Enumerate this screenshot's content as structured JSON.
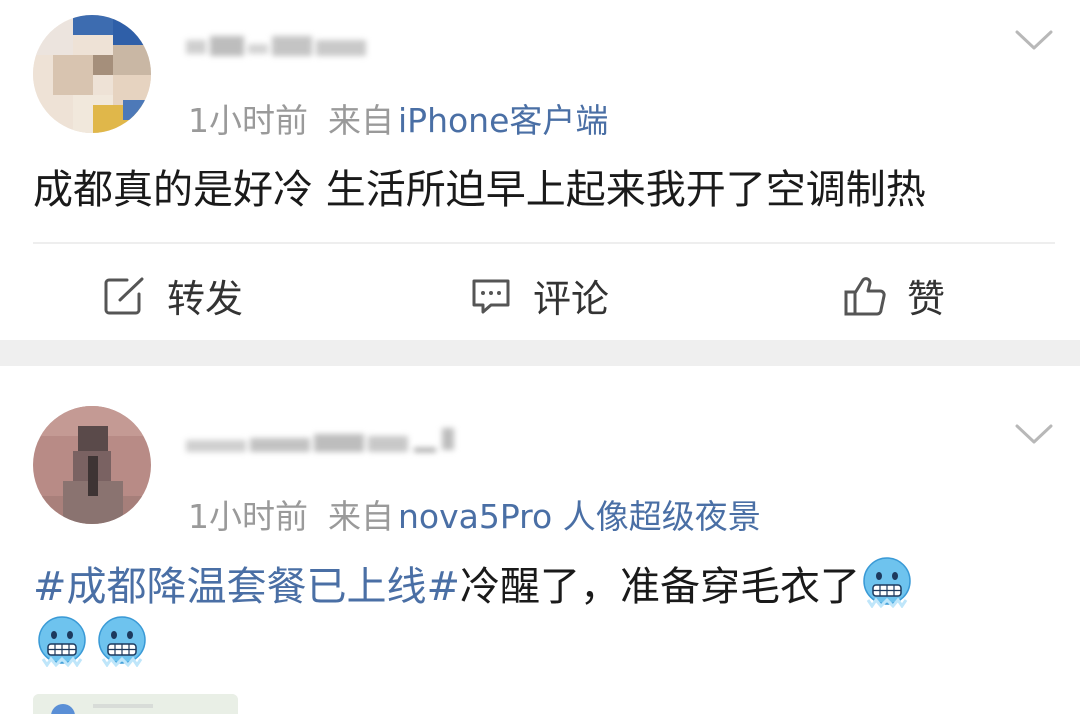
{
  "posts": [
    {
      "time": "1小时前",
      "source_prefix": "来自",
      "source": "iPhone客户端",
      "content": "成都真的是好冷 生活所迫早上起来我开了空调制热",
      "actions": {
        "repost": "转发",
        "comment": "评论",
        "like": "赞"
      }
    },
    {
      "time": "1小时前",
      "source_prefix": "来自",
      "source": "nova5Pro 人像超级夜景",
      "hashtag": "#成都降温套餐已上线#",
      "content": "冷醒了，准备穿毛衣了",
      "emoji": "cold-face"
    }
  ],
  "icons": {
    "chevron": "chevron-down-icon",
    "repost": "edit-square-icon",
    "comment": "comment-bubble-icon",
    "like": "thumbs-up-icon"
  },
  "colors": {
    "link": "#4a6fa5",
    "meta": "#9a9a9a",
    "text": "#1a1a1a",
    "band": "#efefef"
  }
}
